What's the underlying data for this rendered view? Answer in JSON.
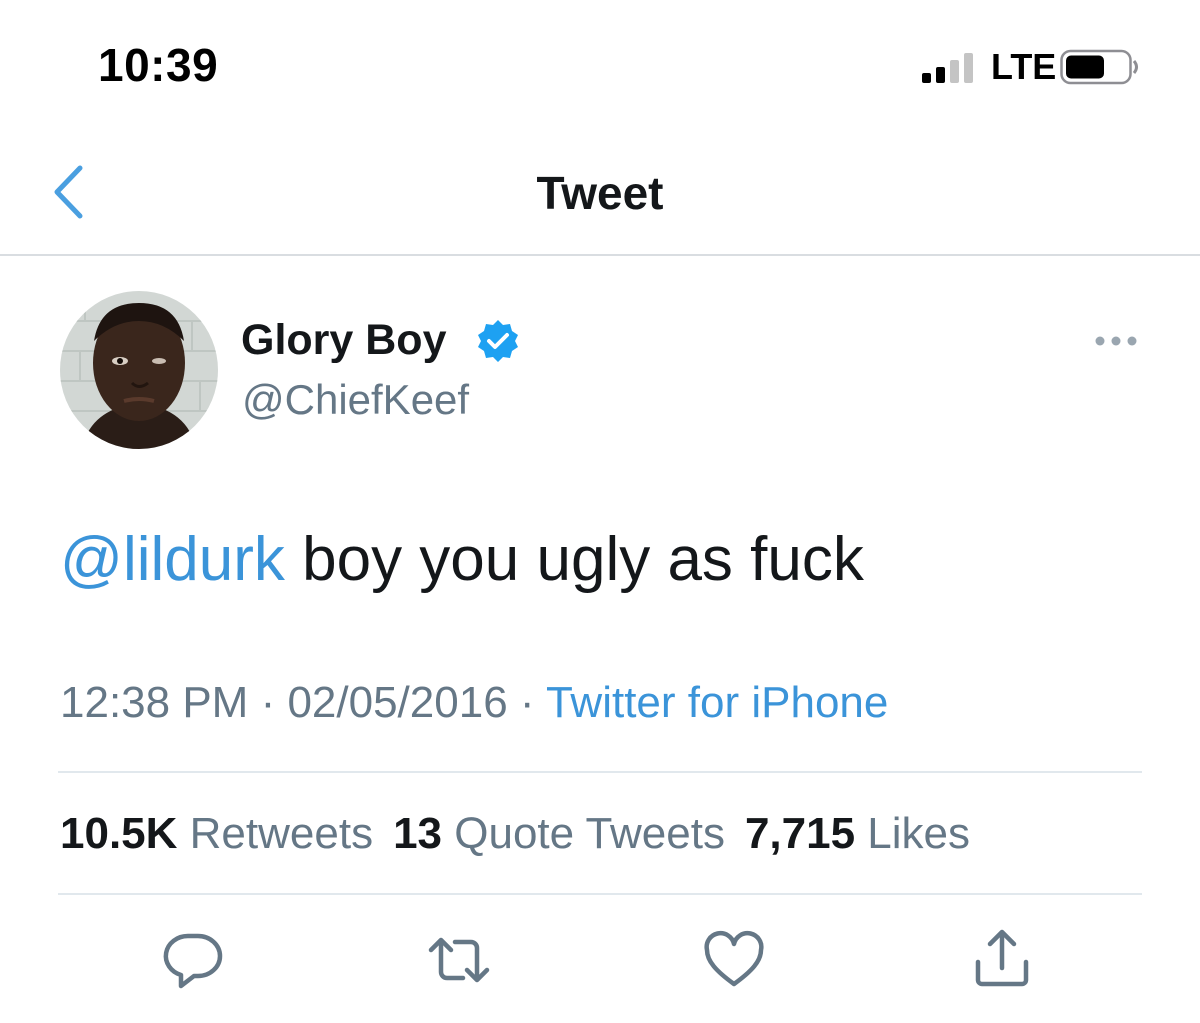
{
  "status_bar": {
    "time": "10:39",
    "network": "LTE",
    "signal_icon": "signal-bars-icon",
    "battery_icon": "battery-icon"
  },
  "nav": {
    "title": "Tweet",
    "back_icon": "chevron-left-icon"
  },
  "author": {
    "name": "Glory Boy",
    "handle": "@ChiefKeef",
    "verified": true,
    "verified_icon": "verified-badge-icon",
    "more_icon": "more-dots-icon"
  },
  "tweet": {
    "mention": "@lildurk",
    "text": " boy you ugly as fuck"
  },
  "meta": {
    "time": "12:38 PM",
    "separator": " · ",
    "date": "02/05/2016",
    "source": "Twitter for iPhone"
  },
  "stats": {
    "retweets_count": "10.5K",
    "retweets_label": "Retweets",
    "quotes_count": "13",
    "quotes_label": "Quote Tweets",
    "likes_count": "7,715",
    "likes_label": "Likes"
  },
  "actions": {
    "reply_icon": "reply-icon",
    "retweet_icon": "retweet-icon",
    "like_icon": "heart-icon",
    "share_icon": "share-icon"
  },
  "colors": {
    "link": "#3b94d9",
    "secondary_text": "#657786",
    "primary_text": "#14171a",
    "verified": "#1da1f2"
  }
}
